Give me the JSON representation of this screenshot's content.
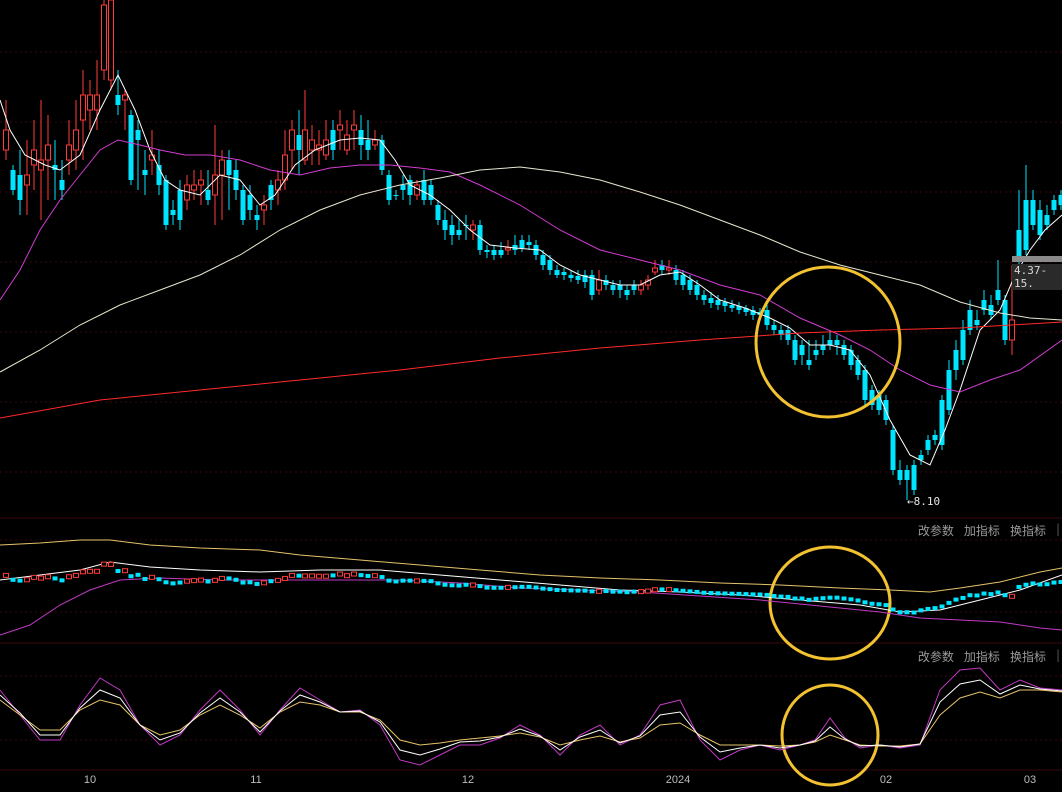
{
  "main_panel": {
    "low_price_label": "8.10",
    "low_arrow": "←",
    "range_label": "4.37-15."
  },
  "indicator_menu_1": {
    "change_params": "改参数",
    "add_indicator": "加指标",
    "switch_indicator": "换指标",
    "more": "|"
  },
  "indicator_menu_2": {
    "change_params": "改参数",
    "add_indicator": "加指标",
    "switch_indicator": "换指标",
    "more": "|"
  },
  "colors": {
    "background": "#000000",
    "bull_candle": "#ff3b3b",
    "bear_candle": "#00e5ff",
    "ma_short": "#ffffff",
    "ma_mid": "#d23cd2",
    "ma_long": "#e8e6d0",
    "ma_longest": "#ff2a2a",
    "annotation_circle": "#f2c230",
    "boll_upper": "#e6c36a",
    "boll_mid": "#ffffff",
    "boll_lower": "#c23ac2",
    "kdj_k": "#ffffff",
    "kdj_d": "#e6c36a",
    "kdj_j": "#c23ac2",
    "grid": "#7a1010"
  },
  "chart_data": {
    "type": "candlestick",
    "x_ticks": [
      "10",
      "11",
      "12",
      "2024",
      "02",
      "03"
    ],
    "visible_low": 8.1,
    "panels": [
      "price_with_moving_averages",
      "bollinger",
      "kdj"
    ],
    "annotations": [
      "circle-main",
      "circle-bollinger",
      "circle-kdj"
    ]
  }
}
